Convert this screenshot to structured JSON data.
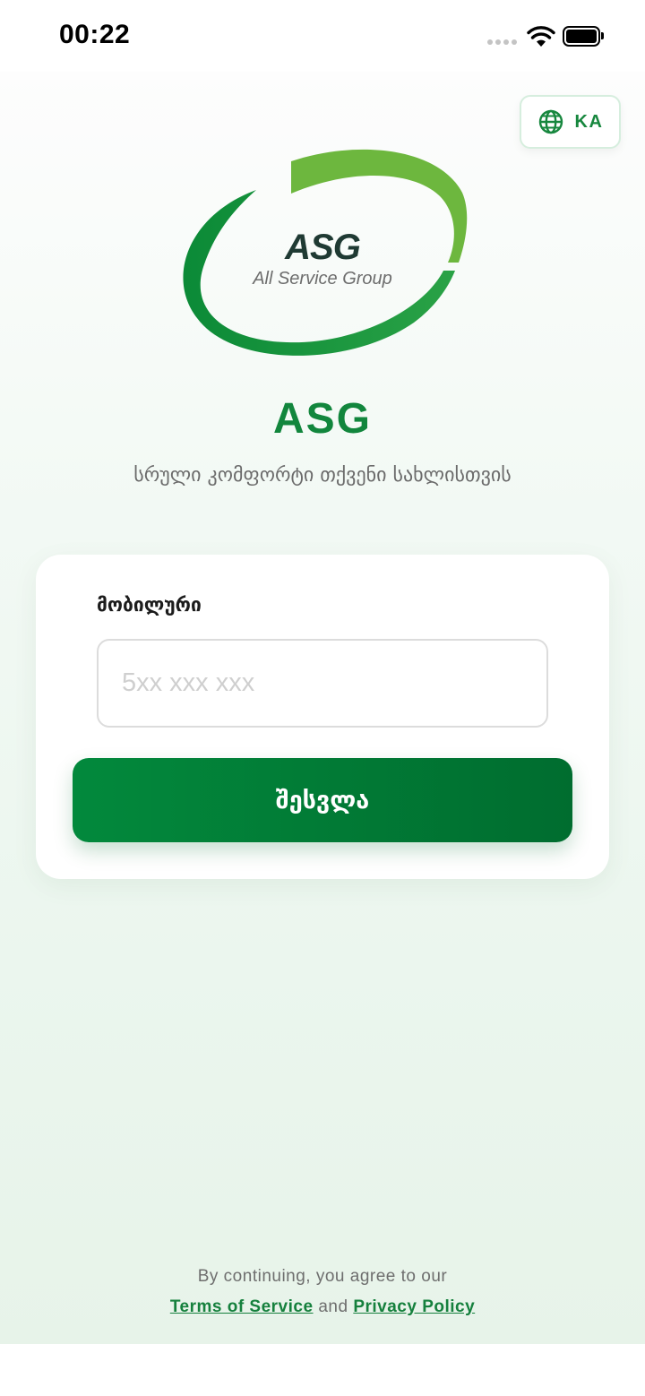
{
  "status_bar": {
    "time": "00:22",
    "icons": [
      "signal-dots-icon",
      "wifi-icon",
      "battery-icon"
    ]
  },
  "language": {
    "label": "KA",
    "icon": "globe-icon"
  },
  "logo": {
    "main_text": "ASG",
    "sub_text": "All Service Group"
  },
  "header": {
    "title": "ASG",
    "tagline": "სრული კომფორტი თქვენი სახლისთვის"
  },
  "login_form": {
    "phone_label": "მობილური",
    "phone_value": "",
    "phone_placeholder": "5xx xxx xxx",
    "submit_label": "შესვლა"
  },
  "footer": {
    "agree_text": "By continuing, you agree to our",
    "terms_link": "Terms of Service",
    "and_text": "and",
    "privacy_link": "Privacy Policy"
  },
  "colors": {
    "brand_green": "#12863d",
    "button_gradient_start": "#02893c",
    "button_gradient_end": "#006d2f",
    "logo_light_green": "#6db73e"
  }
}
